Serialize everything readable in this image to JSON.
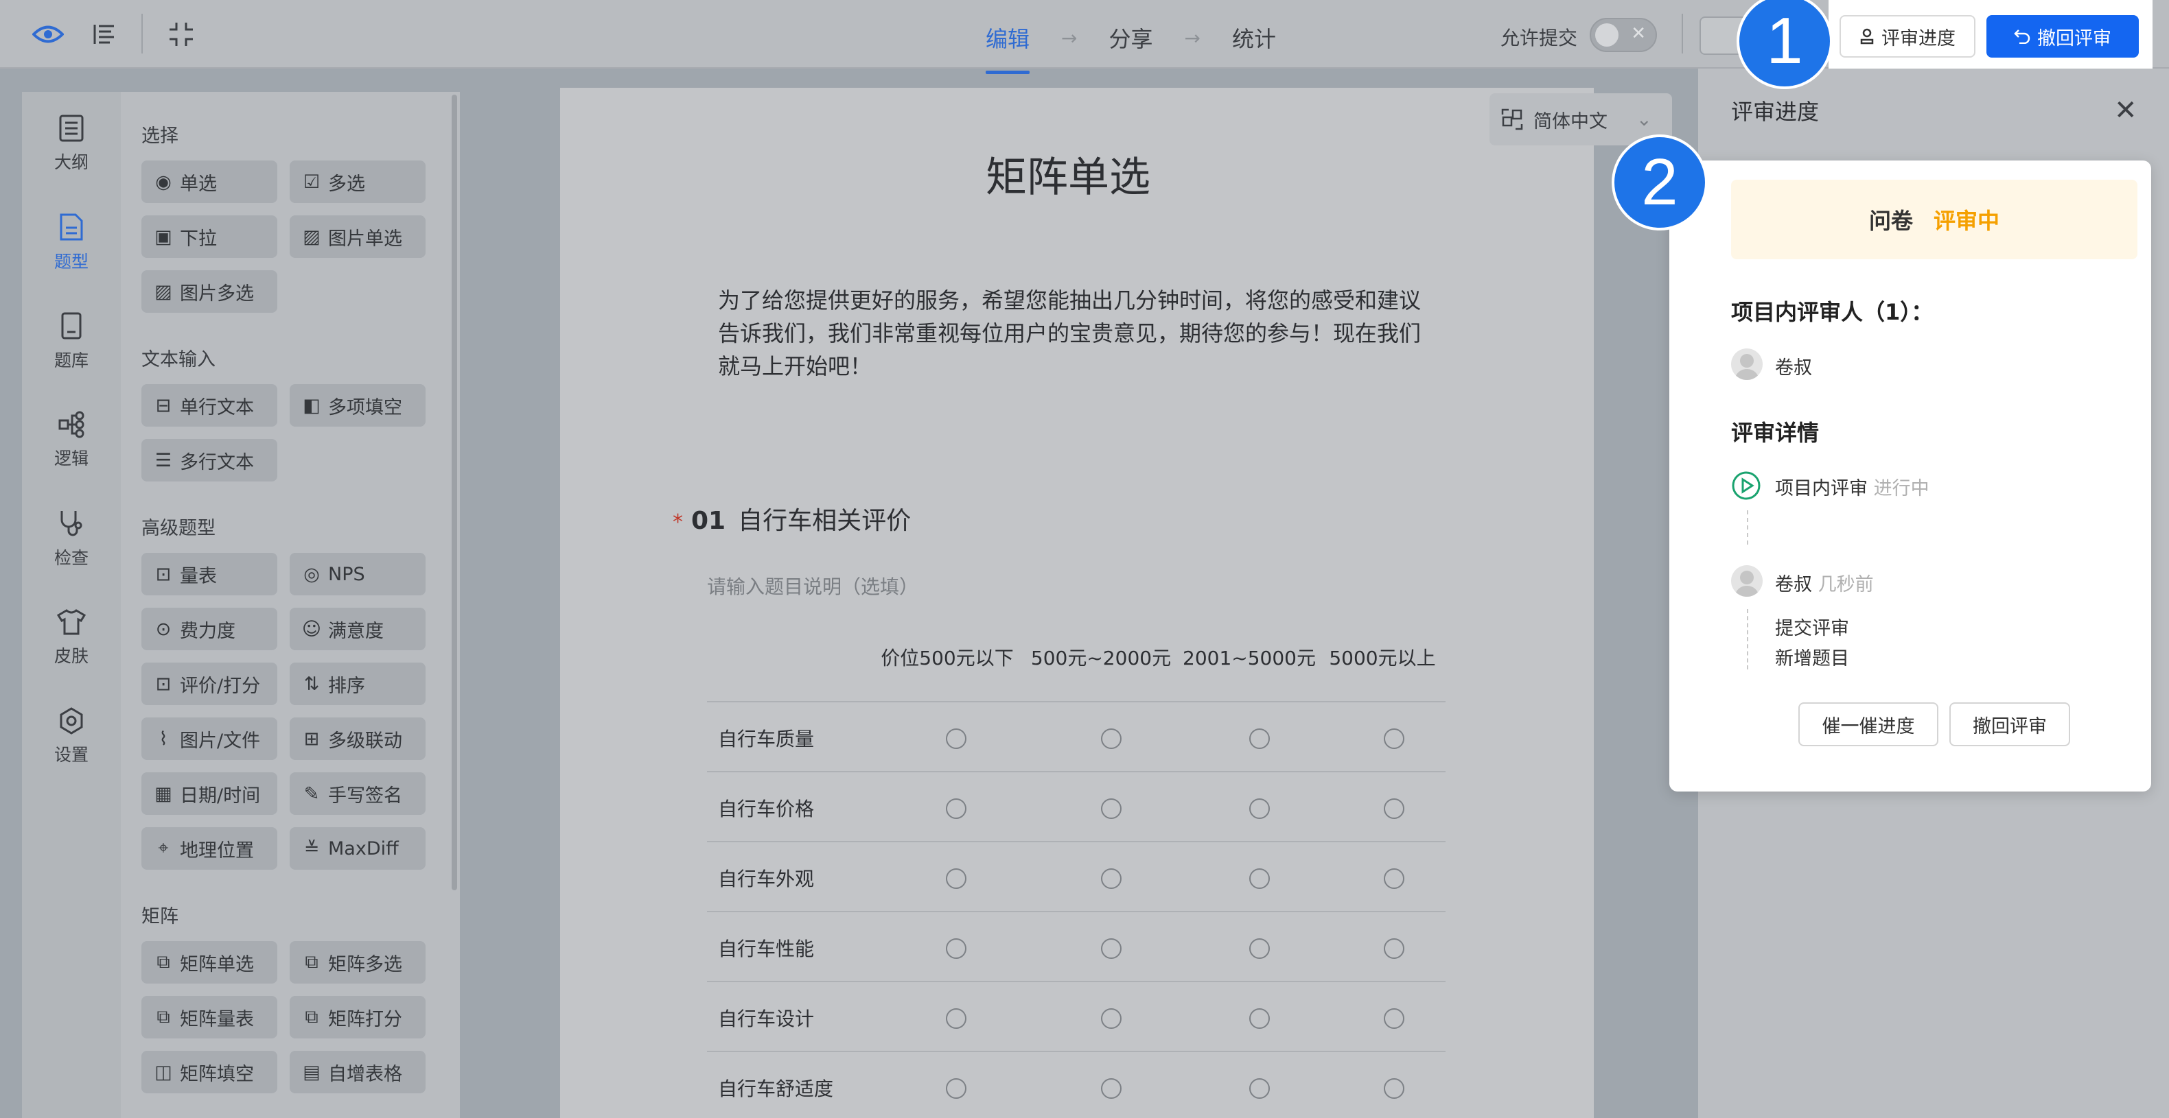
{
  "topbar": {
    "steps": [
      "编辑",
      "分享",
      "统计"
    ],
    "allow_submit_label": "允许提交",
    "review_progress_button": "评审进度",
    "withdraw_review_button": "撤回评审"
  },
  "annotations": {
    "badge1": "1",
    "badge2": "2"
  },
  "rail": {
    "items": [
      {
        "label": "大纲",
        "icon": "outline-icon"
      },
      {
        "label": "题型",
        "icon": "question-type-icon"
      },
      {
        "label": "题库",
        "icon": "question-bank-icon"
      },
      {
        "label": "逻辑",
        "icon": "logic-icon"
      },
      {
        "label": "检查",
        "icon": "check-icon"
      },
      {
        "label": "皮肤",
        "icon": "skin-icon"
      },
      {
        "label": "设置",
        "icon": "settings-icon"
      }
    ]
  },
  "palette": {
    "groups": {
      "select": "选择",
      "text": "文本输入",
      "advanced": "高级题型",
      "matrix": "矩阵"
    },
    "items": {
      "single": "单选",
      "multi": "多选",
      "dropdown": "下拉",
      "img_single": "图片单选",
      "img_multi": "图片多选",
      "line_text": "单行文本",
      "multi_fill": "多项填空",
      "multi_text": "多行文本",
      "scale": "量表",
      "nps": "NPS",
      "effort": "费力度",
      "satisfaction": "满意度",
      "rating": "评价/打分",
      "sort": "排序",
      "file": "图片/文件",
      "cascade": "多级联动",
      "datetime": "日期/时间",
      "signature": "手写签名",
      "location": "地理位置",
      "maxdiff": "MaxDiff",
      "m_single": "矩阵单选",
      "m_multi": "矩阵多选",
      "m_scale": "矩阵量表",
      "m_rating": "矩阵打分",
      "m_fill": "矩阵填空",
      "auto_table": "自增表格"
    }
  },
  "survey": {
    "language": "简体中文",
    "title": "矩阵单选",
    "intro": "为了给您提供更好的服务，希望您能抽出几分钟时间，将您的感受和建议告诉我们，我们非常重视每位用户的宝贵意见，期待您的参与！现在我们就马上开始吧！",
    "question": {
      "required_mark": "*",
      "number": "01",
      "title": "自行车相关评价",
      "description_placeholder": "请输入题目说明（选填）",
      "columns": [
        "价位500元以下",
        "500元~2000元",
        "2001~5000元",
        "5000元以上"
      ],
      "rows": [
        "自行车质量",
        "自行车价格",
        "自行车外观",
        "自行车性能",
        "自行车设计",
        "自行车舒适度"
      ]
    }
  },
  "review_panel": {
    "title": "评审进度",
    "status_label": "问卷",
    "status_value": "评审中",
    "reviewers_heading": "项目内评审人（1）：",
    "reviewer_name": "卷叔",
    "details_heading": "评审详情",
    "stage_name": "项目内评审",
    "stage_status": "进行中",
    "event_user": "卷叔",
    "event_time": "几秒前",
    "event_actions": [
      "提交评审",
      "新增题目"
    ],
    "remind_button": "催一催进度",
    "withdraw_button": "撤回评审"
  }
}
